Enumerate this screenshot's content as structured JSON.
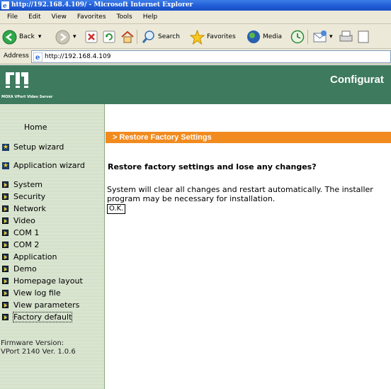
{
  "window": {
    "title": "http://192.168.4.109/ - Microsoft Internet Explorer"
  },
  "menu": [
    "File",
    "Edit",
    "View",
    "Favorites",
    "Tools",
    "Help"
  ],
  "toolbar": {
    "back": "Back",
    "search": "Search",
    "favorites": "Favorites",
    "media": "Media"
  },
  "address": {
    "label": "Address",
    "url": "http://192.168.4.109"
  },
  "header": {
    "brand_sub": "MOXA VPort Video Server",
    "title": "Configurat"
  },
  "sidebar": {
    "home": "Home",
    "items": [
      {
        "label": "Setup wizard",
        "icon": "star-icon"
      },
      {
        "label": "Application wizard",
        "icon": "star-icon"
      },
      {
        "label": "System",
        "icon": "arrow-icon"
      },
      {
        "label": "Security",
        "icon": "arrow-icon"
      },
      {
        "label": "Network",
        "icon": "arrow-icon"
      },
      {
        "label": "Video",
        "icon": "arrow-icon"
      },
      {
        "label": "COM 1",
        "icon": "arrow-icon"
      },
      {
        "label": "COM 2",
        "icon": "arrow-icon"
      },
      {
        "label": "Application",
        "icon": "arrow-icon"
      },
      {
        "label": "Demo",
        "icon": "arrow-icon"
      },
      {
        "label": "Homepage layout",
        "icon": "arrow-icon"
      },
      {
        "label": "View log file",
        "icon": "arrow-icon"
      },
      {
        "label": "View parameters",
        "icon": "arrow-icon"
      },
      {
        "label": "Factory default",
        "icon": "arrow-icon"
      }
    ],
    "firmware_label": "Firmware Version:",
    "firmware_value": "VPort 2140 Ver. 1.0.6"
  },
  "main": {
    "section": "> Restore Factory Settings",
    "question": "Restore factory settings and lose any changes?",
    "description": "System will clear all changes and restart automatically. The installer program may be necessary for installation.",
    "ok_label": "O.K."
  },
  "colors": {
    "header_green": "#3e7a5e",
    "orange": "#f28b1f",
    "sidebar_bg": "#e8f0dc"
  }
}
